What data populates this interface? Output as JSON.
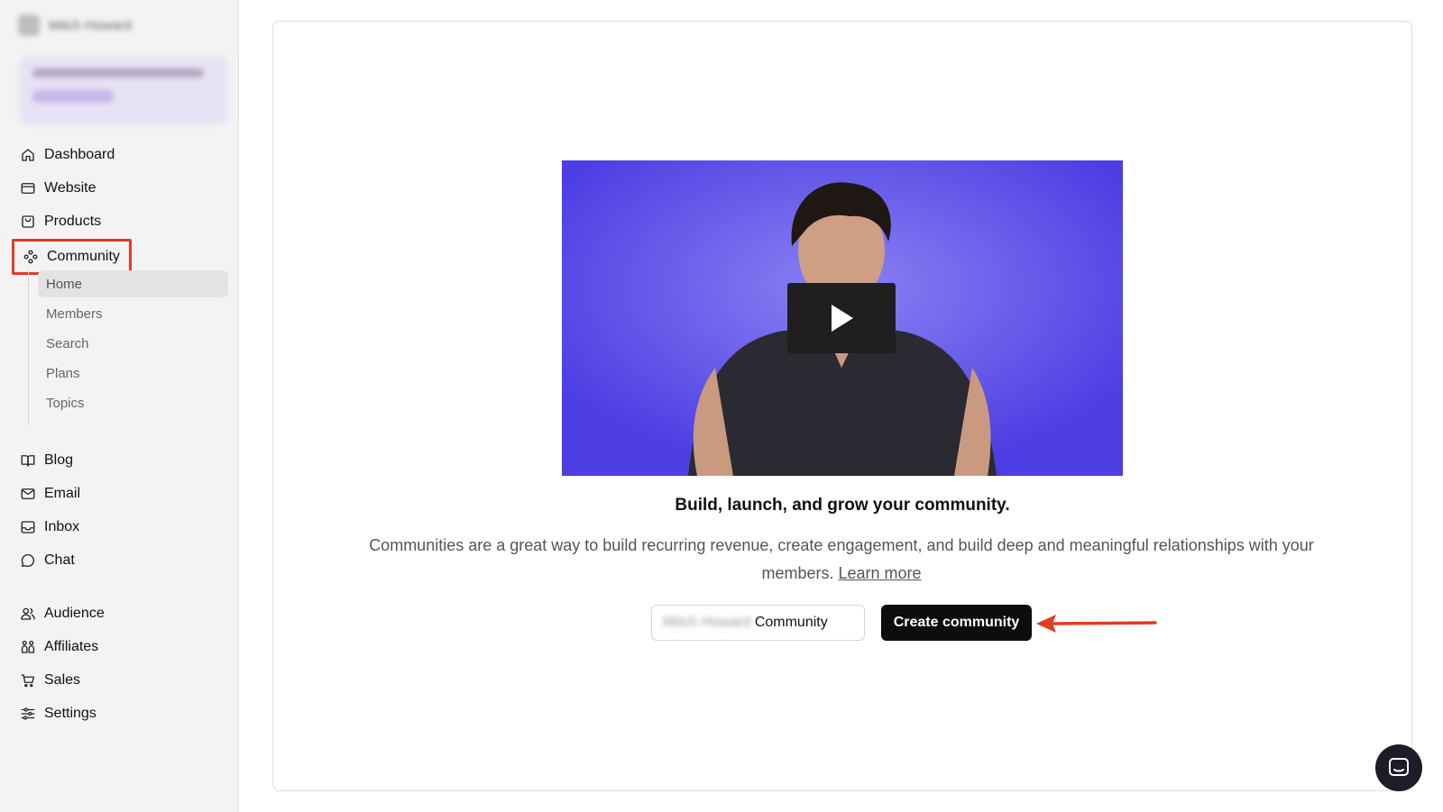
{
  "account": {
    "name": "Mitch Howard"
  },
  "promo": {
    "text": "Your free trial ends in 14 days",
    "cta": "Upgrade"
  },
  "sidebar": {
    "items": [
      {
        "label": "Dashboard",
        "icon": "home-icon"
      },
      {
        "label": "Website",
        "icon": "website-icon"
      },
      {
        "label": "Products",
        "icon": "bag-icon"
      },
      {
        "label": "Community",
        "icon": "community-icon"
      },
      {
        "label": "Blog",
        "icon": "book-icon"
      },
      {
        "label": "Email",
        "icon": "mail-icon"
      },
      {
        "label": "Inbox",
        "icon": "inbox-icon"
      },
      {
        "label": "Chat",
        "icon": "chat-icon"
      },
      {
        "label": "Audience",
        "icon": "users-icon"
      },
      {
        "label": "Affiliates",
        "icon": "affiliates-icon"
      },
      {
        "label": "Sales",
        "icon": "cart-icon"
      },
      {
        "label": "Settings",
        "icon": "sliders-icon"
      }
    ],
    "community_sub": [
      {
        "label": "Home",
        "active": true
      },
      {
        "label": "Members"
      },
      {
        "label": "Search"
      },
      {
        "label": "Plans"
      },
      {
        "label": "Topics"
      }
    ]
  },
  "main": {
    "heading": "Build, launch, and grow your community.",
    "description": "Communities are a great way to build recurring revenue, create engagement, and build deep and meaningful relationships with your members.",
    "learn_more": "Learn more",
    "input_prefix": "Mitch Howard",
    "input_value": "Community",
    "create_button": "Create community"
  },
  "colors": {
    "highlight": "#e23b22",
    "button_bg": "#0d0d0d",
    "video_bg": "#6a5ff0",
    "sidebar_bg": "#f3f3f3"
  }
}
